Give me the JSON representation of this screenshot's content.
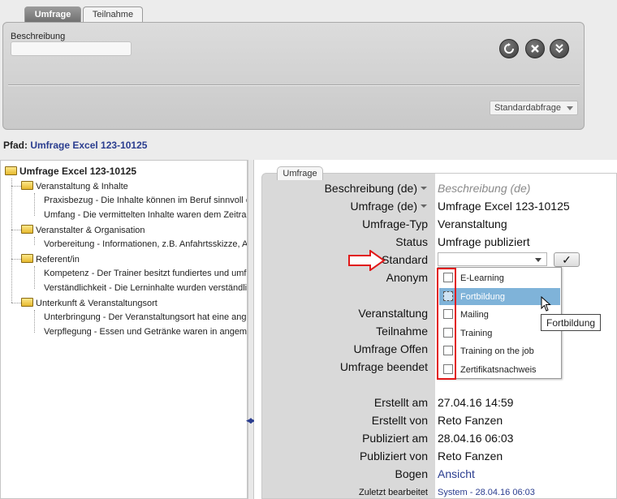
{
  "tabs": [
    "Umfrage",
    "Teilnahme"
  ],
  "search": {
    "label": "Beschreibung",
    "value": "",
    "preset_select": "Standardabfrage"
  },
  "toolbar_icons": [
    "refresh-icon",
    "close-icon",
    "expand-icon"
  ],
  "path": {
    "label": "Pfad:",
    "value": "Umfrage Excel 123-10125"
  },
  "tree": {
    "root": "Umfrage Excel 123-10125",
    "groups": [
      {
        "label": "Veranstaltung & Inhalte",
        "items": [
          "Praxisbezug - Die Inhalte können im Beruf sinnvoll ei",
          "Umfang - Die vermittelten Inhalte waren dem Zeitra"
        ]
      },
      {
        "label": "Veranstalter & Organisation",
        "items": [
          "Vorbereitung - Informationen, z.B. Anfahrtsskizze, A"
        ]
      },
      {
        "label": "Referent/in",
        "items": [
          "Kompetenz - Der Trainer besitzt fundiertes und umfa",
          "Verständlichkeit - Die Lerninhalte wurden verständlic"
        ]
      },
      {
        "label": "Unterkunft & Veranstaltungsort",
        "items": [
          "Unterbringung - Der Veranstaltungsort hat eine ange",
          "Verpflegung - Essen und Getränke waren in angeme"
        ]
      }
    ]
  },
  "detail": {
    "tab": "Umfrage",
    "fields": {
      "beschreibung_label": "Beschreibung (de)",
      "beschreibung_value": "Beschreibung (de)",
      "umfrage_label": "Umfrage (de)",
      "umfrage_value": "Umfrage Excel 123-10125",
      "typ_label": "Umfrage-Typ",
      "typ_value": "Veranstaltung",
      "status_label": "Status",
      "status_value": "Umfrage publiziert",
      "standard_label": "Standard",
      "anonym_label": "Anonym",
      "veranstaltung_label": "Veranstaltung",
      "teilnahme_label": "Teilnahme",
      "offen_label": "Umfrage Offen",
      "beendet_label": "Umfrage beendet",
      "erstellt_am_label": "Erstellt am",
      "erstellt_am_value": "27.04.16 14:59",
      "erstellt_von_label": "Erstellt von",
      "erstellt_von_value": "Reto Fanzen",
      "publiziert_am_label": "Publiziert am",
      "publiziert_am_value": "28.04.16 06:03",
      "publiziert_von_label": "Publiziert von",
      "publiziert_von_value": "Reto Fanzen",
      "bogen_label": "Bogen",
      "bogen_value": "Ansicht",
      "zuletzt_label": "Zuletzt bearbeitet",
      "zuletzt_value": "System - 28.04.16 06:03"
    },
    "apply_button": "✓",
    "dropdown_options": [
      {
        "label": "E-Learning",
        "checked": false
      },
      {
        "label": "Fortbildung",
        "checked": false
      },
      {
        "label": "Mailing",
        "checked": false
      },
      {
        "label": "Training",
        "checked": false
      },
      {
        "label": "Training on the job",
        "checked": false
      },
      {
        "label": "Zertifikatsnachweis",
        "checked": false
      }
    ],
    "tooltip": "Fortbildung"
  },
  "colors": {
    "link": "#2a3d8f",
    "highlight": "#7fb3d9",
    "annotation": "#e11919"
  }
}
